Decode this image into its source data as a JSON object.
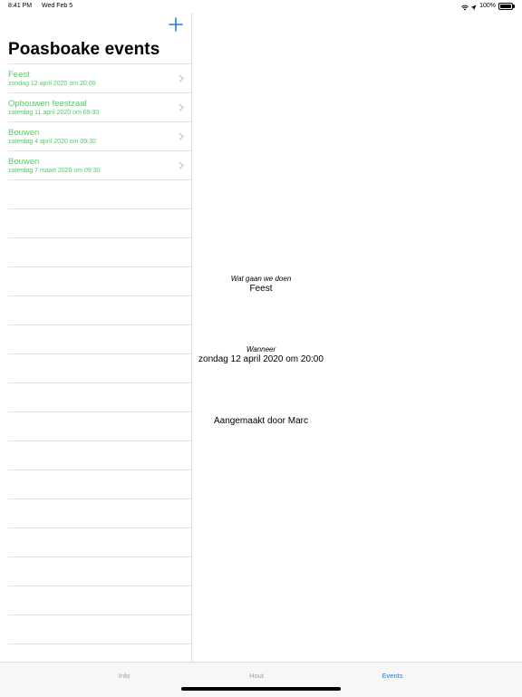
{
  "status_bar": {
    "time": "8:41 PM",
    "date": "Wed Feb 5",
    "battery": "100%",
    "icons": [
      "wifi-icon",
      "location-icon",
      "battery-icon"
    ]
  },
  "master": {
    "add_icon": "plus-icon",
    "title": "Poasboake events",
    "events": [
      {
        "title": "Feest",
        "subtitle": "zondag 12 april 2020 om 20:00"
      },
      {
        "title": "Opbouwen feestzaal",
        "subtitle": "zaterdag 11 april 2020 om 09:30"
      },
      {
        "title": "Bouwen",
        "subtitle": "zaterdag 4 april 2020 om 09:30"
      },
      {
        "title": "Bouwen",
        "subtitle": "zaterdag 7 maart 2020 om 09:30"
      }
    ]
  },
  "detail": {
    "what_label": "Wat gaan we doen",
    "what_value": "Feest",
    "when_label": "Wanneer",
    "when_value": "zondag 12 april 2020 om 20:00",
    "created_by": "Aangemaakt door Marc"
  },
  "tabs": [
    {
      "label": "Info",
      "active": false
    },
    {
      "label": "Hout",
      "active": false
    },
    {
      "label": "Events",
      "active": true
    }
  ],
  "colors": {
    "accent": "#1e7cf2",
    "event_green": "#4fcf62"
  }
}
